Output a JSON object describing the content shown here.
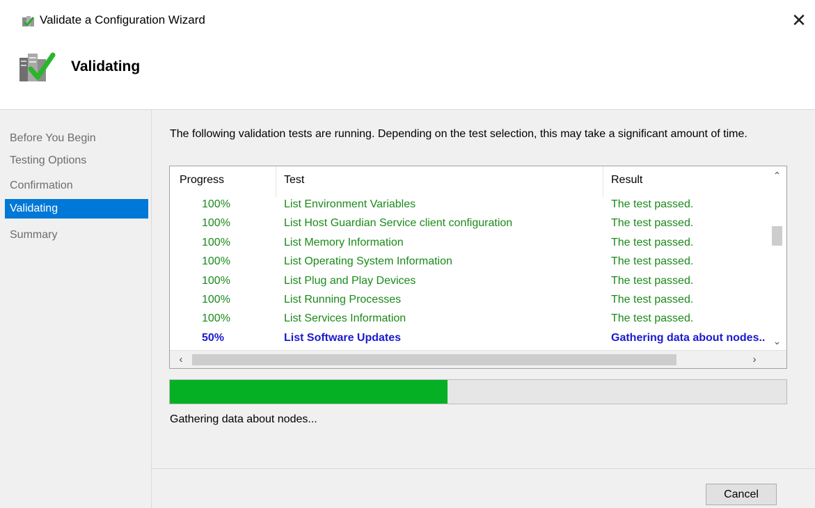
{
  "window": {
    "title": "Validate a Configuration Wizard",
    "icon": "wizard-icon",
    "close_glyph": "✕"
  },
  "header": {
    "title": "Validating",
    "icon": "validate-server-check-icon"
  },
  "sidebar": {
    "items": [
      {
        "label": "Before You Begin",
        "active": false
      },
      {
        "label": "Testing Options",
        "active": false
      },
      {
        "label": "Confirmation",
        "active": false
      },
      {
        "label": "Validating",
        "active": true
      },
      {
        "label": "Summary",
        "active": false
      }
    ]
  },
  "main": {
    "intro": "The following validation tests are running. Depending on the test selection, this may take a significant amount of time.",
    "columns": [
      "Progress",
      "Test",
      "Result"
    ],
    "rows": [
      {
        "progress": "100%",
        "test": "List Environment Variables",
        "result": "The test passed.",
        "status": "passed"
      },
      {
        "progress": "100%",
        "test": "List Host Guardian Service client configuration",
        "result": "The test passed.",
        "status": "passed"
      },
      {
        "progress": "100%",
        "test": "List Memory Information",
        "result": "The test passed.",
        "status": "passed"
      },
      {
        "progress": "100%",
        "test": "List Operating System Information",
        "result": "The test passed.",
        "status": "passed"
      },
      {
        "progress": "100%",
        "test": "List Plug and Play Devices",
        "result": "The test passed.",
        "status": "passed"
      },
      {
        "progress": "100%",
        "test": "List Running Processes",
        "result": "The test passed.",
        "status": "passed"
      },
      {
        "progress": "100%",
        "test": "List Services Information",
        "result": "The test passed.",
        "status": "passed"
      },
      {
        "progress": "50%",
        "test": "List Software Updates",
        "result": "Gathering data about nodes...",
        "status": "running"
      }
    ],
    "overall_progress": 0.45,
    "status_text": "Gathering data about nodes...",
    "cancel_label": "Cancel"
  },
  "colors": {
    "accent": "#0078d7",
    "passed_text": "#1a8a1a",
    "running_text": "#1a1ad0",
    "progress_fill": "#06b025"
  }
}
